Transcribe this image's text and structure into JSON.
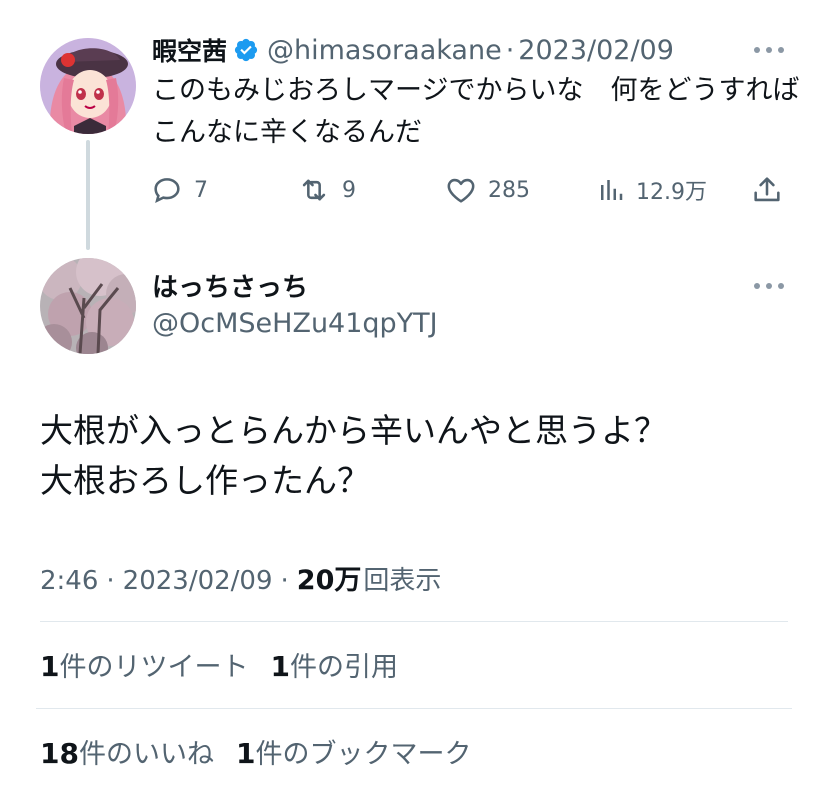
{
  "parent": {
    "display_name": "暇空茜",
    "handle": "@himasoraakane",
    "dot": "·",
    "date": "2023/02/09",
    "text": "このもみじおろしマージでからいな　何をどうすればこんなに辛くなるんだ",
    "avatar_icon": "anime-girl-avatar",
    "verified_color": "#1d9bf0",
    "actions": {
      "replies": "7",
      "retweets": "9",
      "likes": "285",
      "views": "12.9万"
    }
  },
  "reply": {
    "display_name": "はっちさっち",
    "handle": "@OcMSeHZu41qpYTJ",
    "avatar_icon": "cherry-blossom-avatar",
    "text_line1": "大根が入っとらんから辛いんやと思うよ？",
    "text_line2": "大根おろし作ったん？",
    "time": "2:46",
    "dot": "·",
    "date": "2023/02/09",
    "views_count": "20万",
    "views_label": "回表示",
    "stats": {
      "retweets_count": "1",
      "retweets_label": "件のリツイート",
      "quotes_count": "1",
      "quotes_label": "件の引用",
      "likes_count": "18",
      "likes_label": "件のいいね",
      "bookmarks_count": "1",
      "bookmarks_label": "件のブックマーク"
    }
  },
  "colors": {
    "text_primary": "#0f1419",
    "text_secondary": "#536471",
    "divider": "#e1e8ed",
    "thread_line": "#cfd9de"
  }
}
